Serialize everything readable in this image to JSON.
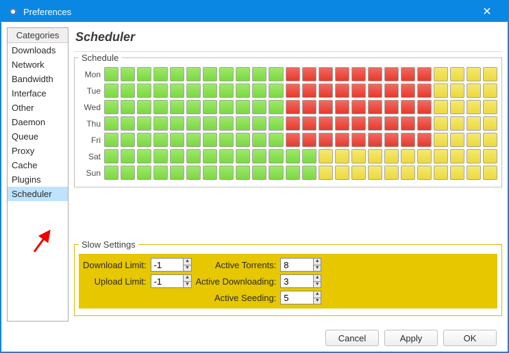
{
  "window": {
    "title": "Preferences",
    "close_glyph": "✕"
  },
  "sidebar": {
    "header": "Categories",
    "items": [
      {
        "label": "Downloads",
        "selected": false
      },
      {
        "label": "Network",
        "selected": false
      },
      {
        "label": "Bandwidth",
        "selected": false
      },
      {
        "label": "Interface",
        "selected": false
      },
      {
        "label": "Other",
        "selected": false
      },
      {
        "label": "Daemon",
        "selected": false
      },
      {
        "label": "Queue",
        "selected": false
      },
      {
        "label": "Proxy",
        "selected": false
      },
      {
        "label": "Cache",
        "selected": false
      },
      {
        "label": "Plugins",
        "selected": false
      },
      {
        "label": "Scheduler",
        "selected": true
      }
    ]
  },
  "pane": {
    "title": "Scheduler"
  },
  "schedule": {
    "legend": "Schedule",
    "days": [
      "Mon",
      "Tue",
      "Wed",
      "Thu",
      "Fri",
      "Sat",
      "Sun"
    ],
    "states": [
      "green",
      "red",
      "yellow"
    ],
    "grid": [
      [
        "green",
        "green",
        "green",
        "green",
        "green",
        "green",
        "green",
        "green",
        "green",
        "green",
        "green",
        "red",
        "red",
        "red",
        "red",
        "red",
        "red",
        "red",
        "red",
        "red",
        "yellow",
        "yellow",
        "yellow",
        "yellow"
      ],
      [
        "green",
        "green",
        "green",
        "green",
        "green",
        "green",
        "green",
        "green",
        "green",
        "green",
        "green",
        "red",
        "red",
        "red",
        "red",
        "red",
        "red",
        "red",
        "red",
        "red",
        "yellow",
        "yellow",
        "yellow",
        "yellow"
      ],
      [
        "green",
        "green",
        "green",
        "green",
        "green",
        "green",
        "green",
        "green",
        "green",
        "green",
        "green",
        "red",
        "red",
        "red",
        "red",
        "red",
        "red",
        "red",
        "red",
        "red",
        "yellow",
        "yellow",
        "yellow",
        "yellow"
      ],
      [
        "green",
        "green",
        "green",
        "green",
        "green",
        "green",
        "green",
        "green",
        "green",
        "green",
        "green",
        "red",
        "red",
        "red",
        "red",
        "red",
        "red",
        "red",
        "red",
        "red",
        "yellow",
        "yellow",
        "yellow",
        "yellow"
      ],
      [
        "green",
        "green",
        "green",
        "green",
        "green",
        "green",
        "green",
        "green",
        "green",
        "green",
        "green",
        "red",
        "red",
        "red",
        "red",
        "red",
        "red",
        "red",
        "red",
        "red",
        "yellow",
        "yellow",
        "yellow",
        "yellow"
      ],
      [
        "green",
        "green",
        "green",
        "green",
        "green",
        "green",
        "green",
        "green",
        "green",
        "green",
        "green",
        "green",
        "green",
        "yellow",
        "yellow",
        "yellow",
        "yellow",
        "yellow",
        "yellow",
        "yellow",
        "yellow",
        "yellow",
        "yellow",
        "yellow"
      ],
      [
        "green",
        "green",
        "green",
        "green",
        "green",
        "green",
        "green",
        "green",
        "green",
        "green",
        "green",
        "green",
        "green",
        "yellow",
        "yellow",
        "yellow",
        "yellow",
        "yellow",
        "yellow",
        "yellow",
        "yellow",
        "yellow",
        "yellow",
        "yellow"
      ]
    ]
  },
  "slow": {
    "legend": "Slow Settings",
    "download_limit_label": "Download Limit:",
    "download_limit_value": "-1",
    "upload_limit_label": "Upload Limit:",
    "upload_limit_value": "-1",
    "active_torrents_label": "Active Torrents:",
    "active_torrents_value": "8",
    "active_downloading_label": "Active Downloading:",
    "active_downloading_value": "3",
    "active_seeding_label": "Active Seeding:",
    "active_seeding_value": "5"
  },
  "buttons": {
    "cancel": "Cancel",
    "apply": "Apply",
    "ok": "OK"
  }
}
